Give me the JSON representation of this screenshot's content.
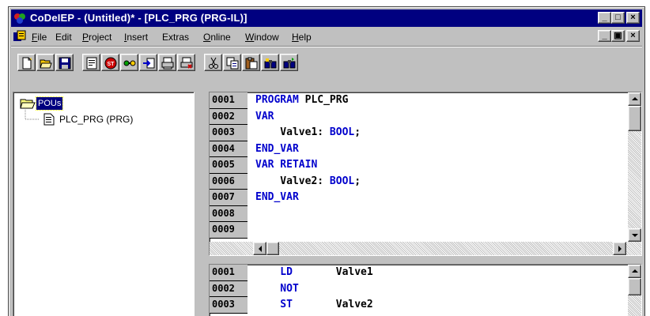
{
  "window": {
    "title": "CoDeIEP - (Untitled)* - [PLC_PRG (PRG-IL)]",
    "minimize_glyph": "_",
    "maximize_glyph": "□",
    "close_glyph": "×",
    "mdi_minimize_glyph": "_",
    "mdi_restore_glyph": "▣",
    "mdi_close_glyph": "×"
  },
  "menu": [
    {
      "underline": "F",
      "rest": "ile"
    },
    {
      "underline": "",
      "rest": "Edit"
    },
    {
      "underline": "P",
      "rest": "roject"
    },
    {
      "underline": "I",
      "rest": "nsert"
    },
    {
      "underline": "",
      "rest": "Extras"
    },
    {
      "underline": "O",
      "rest": "nline"
    },
    {
      "underline": "W",
      "rest": "indow"
    },
    {
      "underline": "H",
      "rest": "elp"
    }
  ],
  "toolbar": {
    "buttons": [
      "new-file",
      "open-folder",
      "save-disk",
      "build",
      "stop",
      "login",
      "logout",
      "print-preview",
      "print",
      "cut",
      "copy",
      "paste",
      "find",
      "find-next"
    ]
  },
  "tree": {
    "root_label": "POUs",
    "child_label": "PLC_PRG (PRG)"
  },
  "declaration": {
    "line_numbers": [
      "0001",
      "0002",
      "0003",
      "0004",
      "0005",
      "0006",
      "0007",
      "0008",
      "0009"
    ],
    "lines": [
      [
        {
          "t": "PROGRAM ",
          "k": true
        },
        {
          "t": "PLC_PRG",
          "k": false
        }
      ],
      [
        {
          "t": "VAR",
          "k": true
        }
      ],
      [
        {
          "t": "    Valve1: ",
          "k": false
        },
        {
          "t": "BOOL",
          "k": true
        },
        {
          "t": ";",
          "k": false
        }
      ],
      [
        {
          "t": "END_VAR",
          "k": true
        }
      ],
      [
        {
          "t": "VAR RETAIN",
          "k": true
        }
      ],
      [
        {
          "t": "    Valve2: ",
          "k": false
        },
        {
          "t": "BOOL",
          "k": true
        },
        {
          "t": ";",
          "k": false
        }
      ],
      [
        {
          "t": "END_VAR",
          "k": true
        }
      ],
      [],
      []
    ]
  },
  "body": {
    "line_numbers": [
      "0001",
      "0002",
      "0003"
    ],
    "lines": [
      [
        {
          "t": "    LD",
          "k": true
        },
        {
          "t": "       Valve1",
          "k": false
        }
      ],
      [
        {
          "t": "    NOT",
          "k": true
        }
      ],
      [
        {
          "t": "    ST",
          "k": true
        },
        {
          "t": "       Valve2",
          "k": false
        }
      ]
    ]
  },
  "colors": {
    "keyword": "#0000cc",
    "titlebar": "#000080",
    "chrome": "#c0c0c0"
  }
}
